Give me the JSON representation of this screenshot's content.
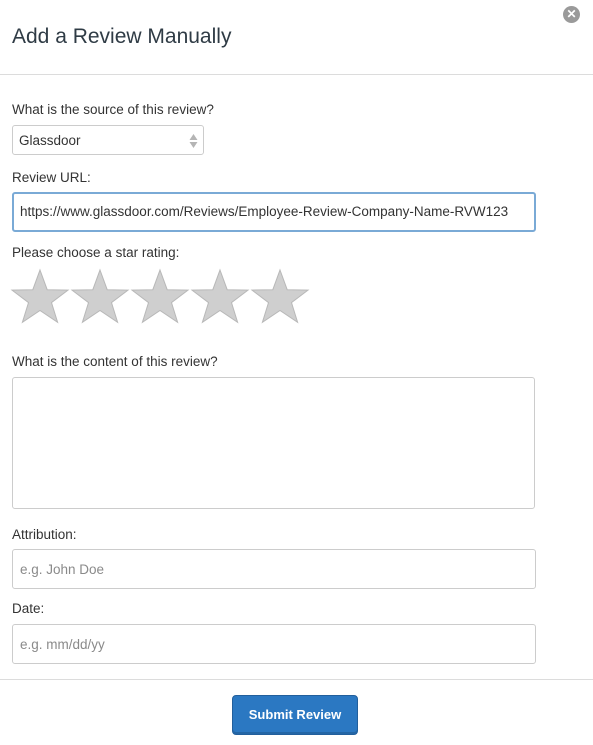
{
  "dialog": {
    "title": "Add a Review Manually",
    "close_icon": "close-icon"
  },
  "form": {
    "source_label": "What is the source of this review?",
    "source_selected": "Glassdoor",
    "url_label": "Review URL:",
    "url_value": "https://www.glassdoor.com/Reviews/Employee-Review-Company-Name-RVW123",
    "rating_label": "Please choose a star rating:",
    "rating_value": 0,
    "rating_max": 5,
    "content_label": "What is the content of this review?",
    "content_value": "",
    "attribution_label": "Attribution:",
    "attribution_placeholder": "e.g. John Doe",
    "date_label": "Date:",
    "date_placeholder": "e.g. mm/dd/yy"
  },
  "actions": {
    "submit_label": "Submit Review"
  },
  "colors": {
    "accent": "#2b78c2",
    "star_empty": "#cfcfcf",
    "focus_border": "#7aaad6"
  }
}
